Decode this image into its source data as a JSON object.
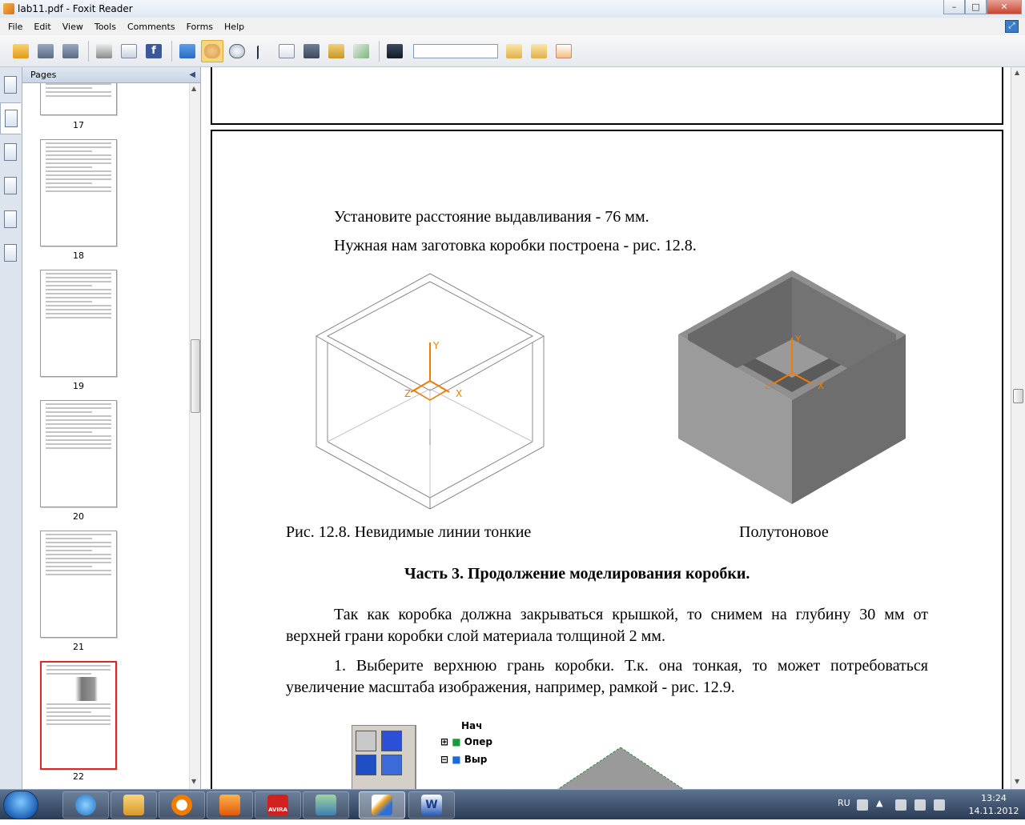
{
  "window": {
    "title": "lab11.pdf - Foxit Reader"
  },
  "window_controls": {
    "minimize": "–",
    "maximize": "□",
    "close": "✕"
  },
  "menu": [
    "File",
    "Edit",
    "View",
    "Tools",
    "Comments",
    "Forms",
    "Help"
  ],
  "toolbar": {
    "search_value": "",
    "active_tool": "hand"
  },
  "pages_panel": {
    "title": "Pages",
    "thumbnails": [
      {
        "label": "17"
      },
      {
        "label": "18"
      },
      {
        "label": "19"
      },
      {
        "label": "20"
      },
      {
        "label": "21"
      },
      {
        "label": "22",
        "selected": true
      }
    ]
  },
  "document": {
    "line1": "Установите расстояние выдавливания - 76 мм.",
    "line2": "Нужная нам заготовка коробки построена - рис. 12.8.",
    "figure_axes": {
      "y": "Y",
      "z": "Z",
      "x": "X"
    },
    "caption_left": "Рис. 12.8. Невидимые линии тонкие",
    "caption_right": "Полутоновое",
    "heading": "Часть 3. Продолжение моделирования коробки.",
    "para1": "Так как коробка должна закрываться крышкой, то снимем на глубину 30 мм от верхней грани коробки слой материала толщиной 2 мм.",
    "para2": "1. Выберите верхнюю грань коробки. Т.к. она тонкая, то может потребоваться увеличение масштаба изображения, например, рамкой - рис. 12.9.",
    "tree_items": [
      "Нач",
      "Опер",
      "Выр"
    ]
  },
  "taskbar": {
    "apps": [
      "internet-explorer",
      "windows-explorer",
      "mail",
      "media-player",
      "avira",
      "network-users",
      "foxit-reader",
      "word"
    ],
    "avira_label": "AVIRA",
    "language": "RU",
    "time": "13:24",
    "date": "14.11.2012"
  },
  "colors": {
    "accent_selection": "#e0262a",
    "axis_orange": "#f07d00",
    "toolbar_active": "#f7d77c"
  }
}
